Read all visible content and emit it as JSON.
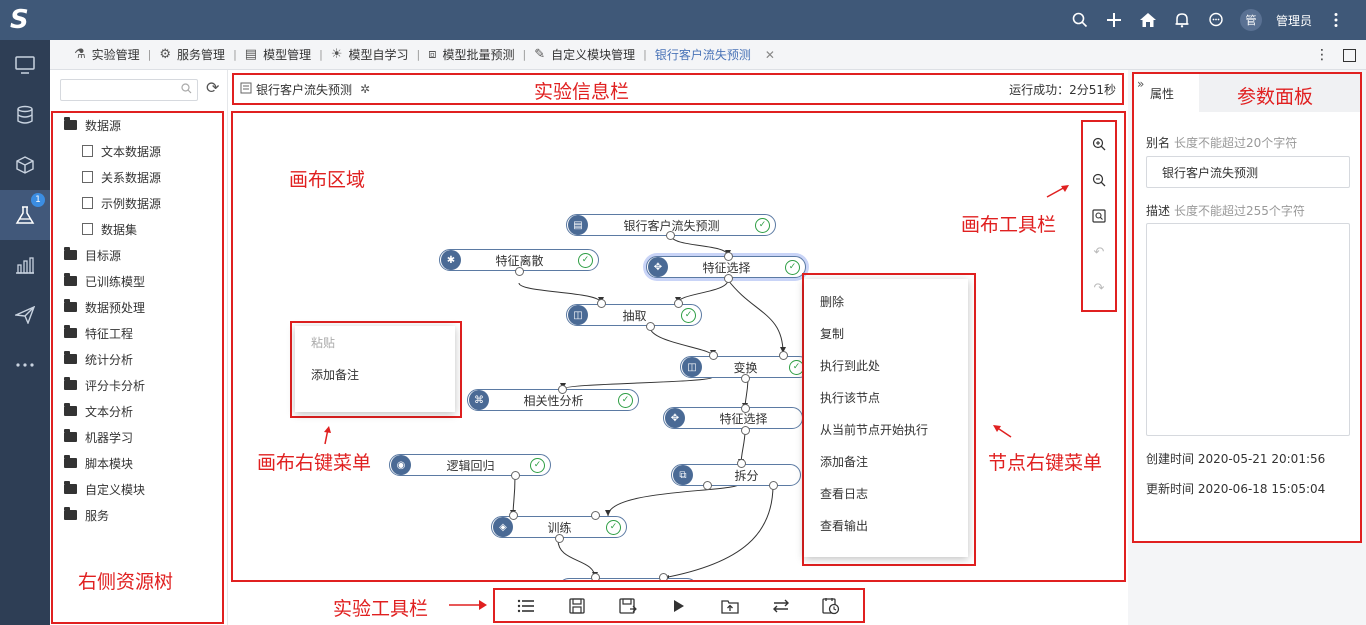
{
  "topbar": {
    "logo": "S",
    "avatar": "管",
    "user_name": "管理员",
    "icons": [
      "search-icon",
      "add-icon",
      "home-icon",
      "bell-icon",
      "chat-icon",
      "more-vertical-icon"
    ]
  },
  "leftnav": {
    "items": [
      "monitor-icon",
      "database-icon",
      "cube-icon",
      "experiment-icon",
      "chart-icon",
      "send-icon",
      "more-icon"
    ],
    "badge": "1"
  },
  "tabs": [
    {
      "label": "实验管理",
      "icon": "flask-icon"
    },
    {
      "label": "服务管理",
      "icon": "service-icon"
    },
    {
      "label": "模型管理",
      "icon": "model-icon"
    },
    {
      "label": "模型自学习",
      "icon": "bulb-icon"
    },
    {
      "label": "模型批量预测",
      "icon": "line-chart-icon"
    },
    {
      "label": "自定义模块管理",
      "icon": "pen-icon"
    },
    {
      "label": "银行客户流失预测",
      "active": true
    }
  ],
  "tree": {
    "items": [
      {
        "label": "数据源",
        "level": 0,
        "icon": "folder-open-icon"
      },
      {
        "label": "文本数据源",
        "level": 1,
        "icon": "text-datasource-icon"
      },
      {
        "label": "关系数据源",
        "level": 1,
        "icon": "relational-datasource-icon"
      },
      {
        "label": "示例数据源",
        "level": 1,
        "icon": "sample-datasource-icon"
      },
      {
        "label": "数据集",
        "level": 1,
        "icon": "dataset-icon"
      },
      {
        "label": "目标源",
        "level": 0,
        "icon": "folder-icon"
      },
      {
        "label": "已训练模型",
        "level": 0,
        "icon": "folder-icon"
      },
      {
        "label": "数据预处理",
        "level": 0,
        "icon": "folder-icon"
      },
      {
        "label": "特征工程",
        "level": 0,
        "icon": "folder-icon"
      },
      {
        "label": "统计分析",
        "level": 0,
        "icon": "folder-icon"
      },
      {
        "label": "评分卡分析",
        "level": 0,
        "icon": "folder-icon"
      },
      {
        "label": "文本分析",
        "level": 0,
        "icon": "folder-icon"
      },
      {
        "label": "机器学习",
        "level": 0,
        "icon": "folder-icon"
      },
      {
        "label": "脚本模块",
        "level": 0,
        "icon": "folder-icon"
      },
      {
        "label": "自定义模块",
        "level": 0,
        "icon": "folder-icon"
      },
      {
        "label": "服务",
        "level": 0,
        "icon": "folder-icon"
      }
    ]
  },
  "infobar": {
    "experiment_name": "银行客户流失预测",
    "run_status": "运行成功：2分51秒"
  },
  "canvas": {
    "nodes": [
      {
        "label": "银行客户流失预测"
      },
      {
        "label": "特征离散"
      },
      {
        "label": "特征选择"
      },
      {
        "label": "抽取"
      },
      {
        "label": "变换"
      },
      {
        "label": "相关性分析"
      },
      {
        "label": "特征选择"
      },
      {
        "label": "逻辑回归"
      },
      {
        "label": "拆分"
      },
      {
        "label": "训练"
      }
    ],
    "canvas_menu": [
      "粘贴",
      "添加备注"
    ],
    "node_menu": [
      "删除",
      "复制",
      "执行到此处",
      "执行该节点",
      "从当前节点开始执行",
      "添加备注",
      "查看日志",
      "查看输出"
    ],
    "toolbar_icons": [
      "zoom-in-icon",
      "zoom-out-icon",
      "fit-view-icon",
      "undo-icon",
      "redo-icon"
    ]
  },
  "annotations": {
    "info_bar": "实验信息栏",
    "params_panel": "参数面板",
    "canvas_area": "画布区域",
    "canvas_toolbar": "画布工具栏",
    "canvas_menu": "画布右键菜单",
    "node_menu": "节点右键菜单",
    "resource_tree": "右侧资源树",
    "exp_toolbar": "实验工具栏"
  },
  "props": {
    "tab": "属性",
    "alias_label": "别名",
    "alias_hint": "长度不能超过20个字符",
    "alias_value": "银行客户流失预测",
    "desc_label": "描述",
    "desc_hint": "长度不能超过255个字符",
    "created": "创建时间 2020-05-21 20:01:56",
    "updated": "更新时间 2020-06-18 15:05:04"
  },
  "exp_toolbar": {
    "icons": [
      "list-icon",
      "save-icon",
      "save-as-icon",
      "run-icon",
      "publish-icon",
      "swap-icon",
      "schedule-icon"
    ]
  },
  "colors": {
    "topbar": "#3f5878",
    "leftnav": "#2e3e55",
    "highlight_red": "#e02020",
    "node_blue": "#4a6a95",
    "check_green": "#2e9e44"
  }
}
